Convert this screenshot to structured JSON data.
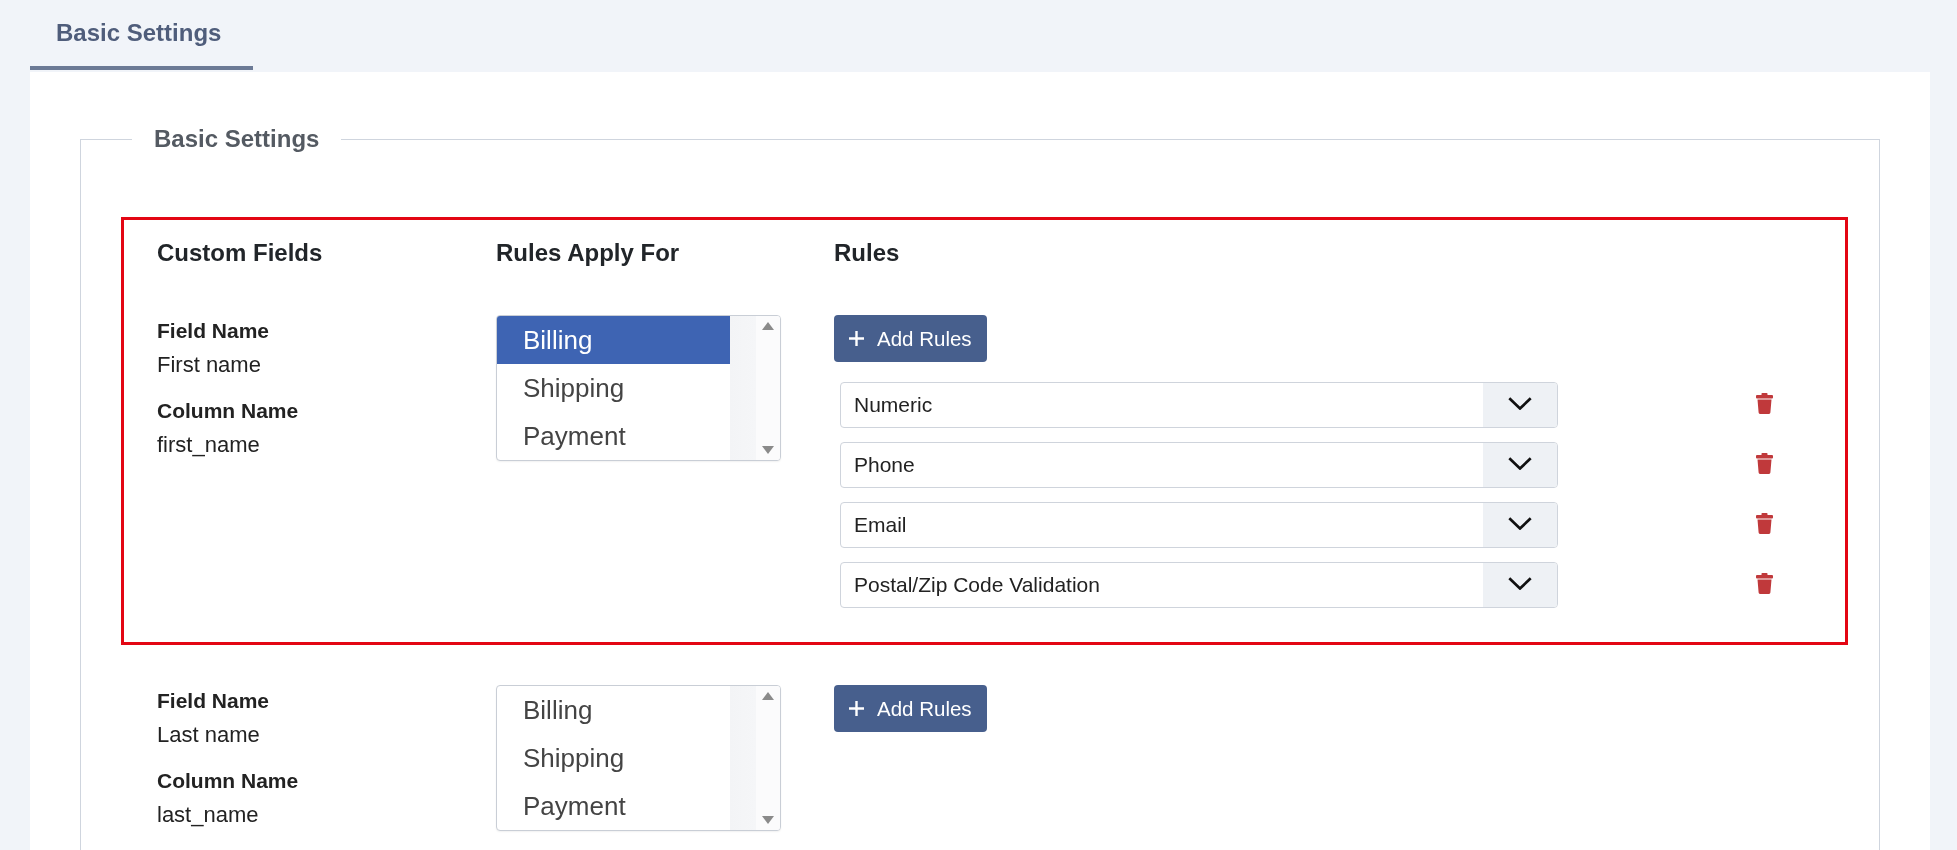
{
  "tabs": [
    {
      "label": "Basic Settings",
      "selected": true
    }
  ],
  "fieldset": {
    "legend": "Basic Settings",
    "columns": [
      "Custom Fields",
      "Rules Apply For",
      "Rules"
    ],
    "fields": [
      {
        "highlighted": true,
        "field_name_label": "Field Name",
        "field_name": "First name",
        "column_name_label": "Column Name",
        "column_name": "first_name",
        "apply_for": [
          {
            "label": "Billing",
            "selected": true
          },
          {
            "label": "Shipping",
            "selected": false
          },
          {
            "label": "Payment",
            "selected": false
          }
        ],
        "add_button": "Add Rules",
        "rules": [
          {
            "value": "Numeric"
          },
          {
            "value": "Phone"
          },
          {
            "value": "Email"
          },
          {
            "value": "Postal/Zip Code Validation"
          }
        ]
      },
      {
        "highlighted": false,
        "field_name_label": "Field Name",
        "field_name": "Last name",
        "column_name_label": "Column Name",
        "column_name": "last_name",
        "apply_for": [
          {
            "label": "Billing",
            "selected": false
          },
          {
            "label": "Shipping",
            "selected": false
          },
          {
            "label": "Payment",
            "selected": false
          }
        ],
        "add_button": "Add Rules"
      }
    ]
  }
}
